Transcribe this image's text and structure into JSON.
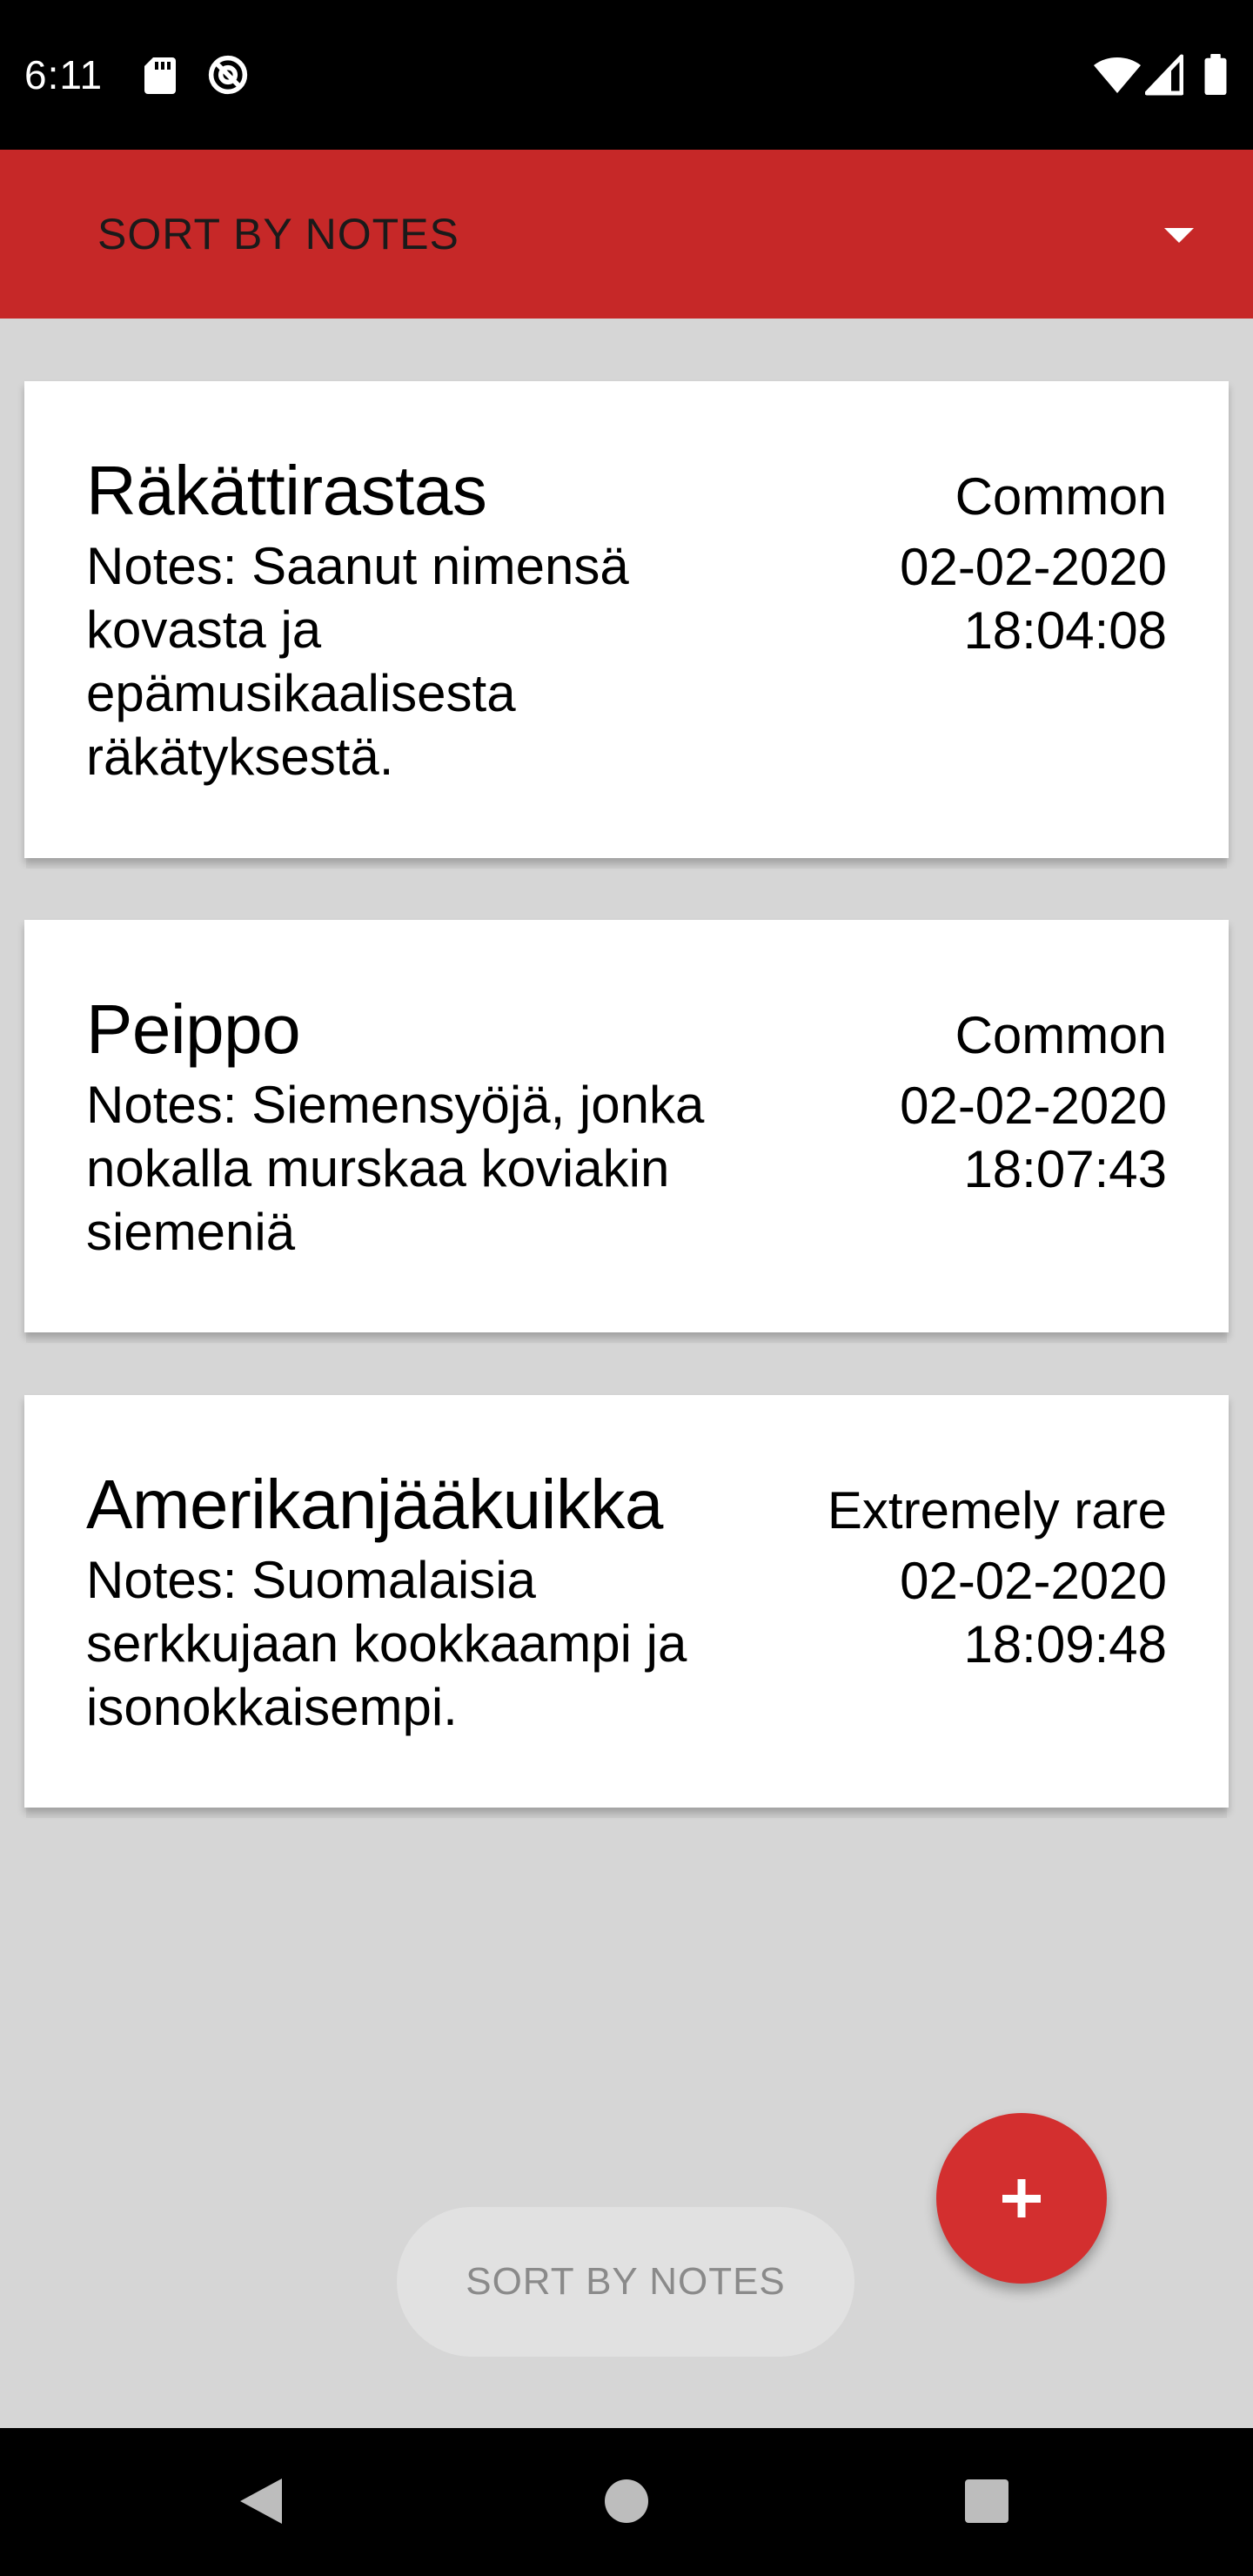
{
  "status_bar": {
    "time": "6:11",
    "left_icons": [
      "sd-card-icon",
      "do-not-disturb-icon"
    ],
    "right_icons": [
      "wifi-icon",
      "cell-signal-icon",
      "battery-icon"
    ]
  },
  "sort_dropdown": {
    "selected": "SORT BY NOTES",
    "icon": "dropdown-arrow-icon",
    "background": "#c62828"
  },
  "birds": [
    {
      "name": "Räkättirastas",
      "notes": "Notes: Saanut nimensä kovasta ja epämusikaalisesta räkätyksestä.",
      "rarity": "Common",
      "date": "02-02-2020",
      "time": "18:04:08"
    },
    {
      "name": "Peippo",
      "notes": "Notes: Siemensyöjä, jonka nokalla murskaa koviakin siemeniä",
      "rarity": "Common",
      "date": "02-02-2020",
      "time": "18:07:43"
    },
    {
      "name": "Amerikanjääkuikka",
      "notes": "Notes: Suomalaisia serkkujaan kookkaampi ja isonokkaisempi.",
      "rarity": "Extremely rare",
      "date": "02-02-2020",
      "time": "18:09:48"
    }
  ],
  "sort_button": {
    "label": "SORT BY NOTES"
  },
  "fab": {
    "icon": "plus-icon",
    "color": "#d32f2f"
  },
  "nav_bar": {
    "icons": [
      "back-icon",
      "home-icon",
      "recents-icon"
    ]
  }
}
